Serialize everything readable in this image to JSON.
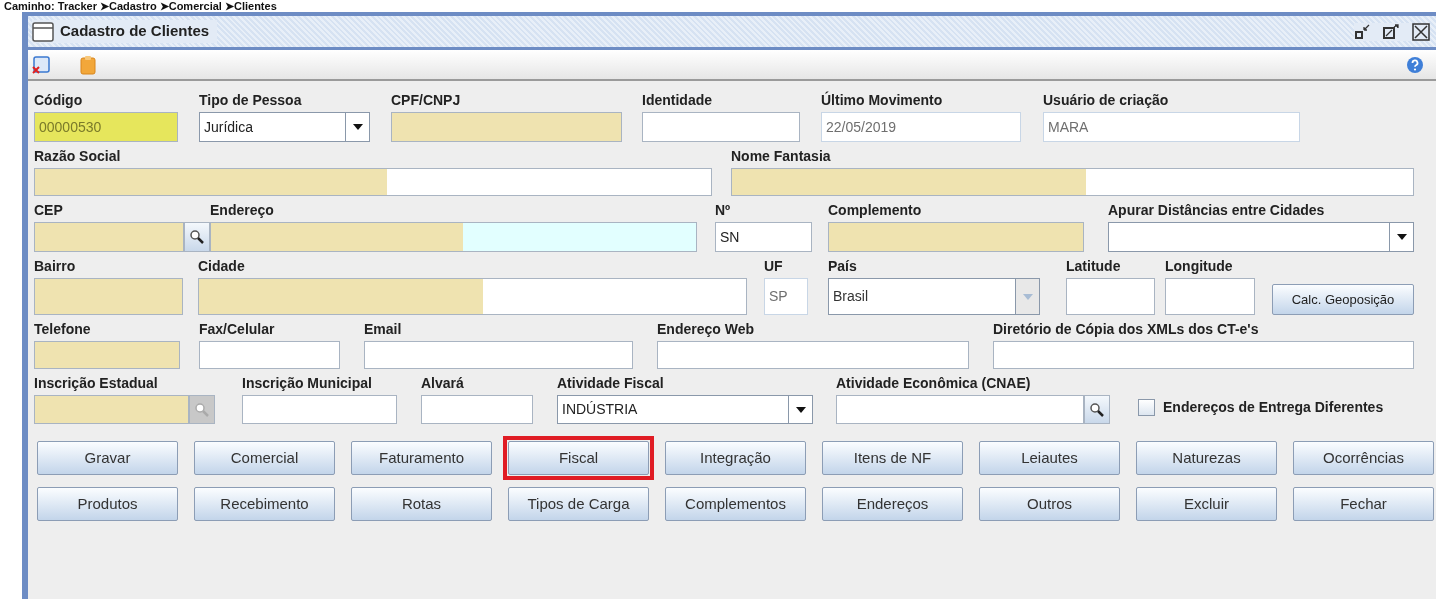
{
  "breadcrumb": "Caminho: Tracker ➤Cadastro ➤Comercial ➤Clientes",
  "window": {
    "title": "Cadastro de Clientes"
  },
  "rows": [
    [
      {
        "kind": "key",
        "label": "Código",
        "value": "00000530",
        "required": false,
        "partial": false
      },
      {
        "kind": "combo",
        "label": "Tipo de Pessoa",
        "value": "Jurídica",
        "required": false,
        "partial": false
      },
      {
        "kind": "text",
        "label": "CPF/CNPJ",
        "required": true,
        "partial": false
      },
      {
        "kind": "text",
        "label": "Identidade",
        "required": false,
        "partial": false
      },
      {
        "kind": "text",
        "label": "Último Movimento",
        "value": "22/05/2019",
        "required": false,
        "partial": false,
        "disabled": true
      },
      {
        "kind": "text",
        "label": "Usuário de criação",
        "value": "MARA",
        "required": false,
        "partial": false,
        "disabled": true
      }
    ],
    [
      {
        "kind": "text",
        "label": "Razão Social",
        "required": false,
        "partial": true
      },
      {
        "kind": "text",
        "label": "Nome Fantasia",
        "required": false,
        "partial": true
      }
    ],
    [
      {
        "kind": "lookup",
        "label": "CEP",
        "required": true,
        "partial": false,
        "disabled": false
      },
      {
        "kind": "text",
        "label": "Endereço",
        "required": false,
        "partial": true,
        "focused": true
      },
      {
        "kind": "text",
        "label": "Nº",
        "value": "SN",
        "required": false,
        "partial": false
      },
      {
        "kind": "text",
        "label": "Complemento",
        "required": true,
        "partial": false
      },
      {
        "kind": "combo",
        "label": "Apurar Distâncias entre Cidades",
        "required": false,
        "partial": false
      }
    ],
    [
      {
        "kind": "text",
        "label": "Bairro",
        "required": true,
        "partial": false
      },
      {
        "kind": "text",
        "label": "Cidade",
        "required": false,
        "partial": true
      },
      {
        "kind": "text",
        "label": "UF",
        "value": "SP",
        "required": false,
        "partial": false,
        "disabled": true
      },
      {
        "kind": "combo",
        "label": "País",
        "value": "Brasil",
        "required": false,
        "partial": false,
        "disabled": true
      },
      {
        "kind": "text",
        "label": "Latitude",
        "required": false,
        "partial": false
      },
      {
        "kind": "text",
        "label": "Longitude",
        "required": false,
        "partial": false
      },
      {
        "kind": "button",
        "label": "Calc. Geoposição"
      }
    ],
    [
      {
        "kind": "text",
        "label": "Telefone",
        "required": true,
        "partial": false
      },
      {
        "kind": "text",
        "label": "Fax/Celular",
        "required": false,
        "partial": false
      },
      {
        "kind": "text",
        "label": "Email",
        "required": false,
        "partial": false
      },
      {
        "kind": "text",
        "label": "Endereço Web",
        "required": false,
        "partial": false
      },
      {
        "kind": "text",
        "label": "Diretório de Cópia dos XMLs dos CT-e's",
        "required": false,
        "partial": false
      }
    ],
    [
      {
        "kind": "lookup",
        "label": "Inscrição Estadual",
        "required": true,
        "partial": false,
        "disabled": true
      },
      {
        "kind": "text",
        "label": "Inscrição Municipal",
        "required": false,
        "partial": false
      },
      {
        "kind": "text",
        "label": "Alvará",
        "required": false,
        "partial": false
      },
      {
        "kind": "combo",
        "label": "Atividade Fiscal",
        "value": "INDÚSTRIA",
        "required": false,
        "partial": false
      },
      {
        "kind": "lookup",
        "label": "Atividade Econômica (CNAE)",
        "required": false,
        "partial": false,
        "disabled": false
      },
      {
        "kind": "checkbox",
        "label": "Endereços de Entrega Diferentes",
        "checked": false
      }
    ]
  ],
  "buttons": [
    [
      {
        "label": "Gravar",
        "highlighted": false
      },
      {
        "label": "Comercial",
        "highlighted": false
      },
      {
        "label": "Faturamento",
        "highlighted": false
      },
      {
        "label": "Fiscal",
        "highlighted": true
      },
      {
        "label": "Integração",
        "highlighted": false
      },
      {
        "label": "Itens de NF",
        "highlighted": false
      },
      {
        "label": "Leiautes",
        "highlighted": false
      },
      {
        "label": "Naturezas",
        "highlighted": false
      },
      {
        "label": "Ocorrências",
        "highlighted": false
      }
    ],
    [
      {
        "label": "Produtos",
        "highlighted": false
      },
      {
        "label": "Recebimento",
        "highlighted": false
      },
      {
        "label": "Rotas",
        "highlighted": false
      },
      {
        "label": "Tipos de Carga",
        "highlighted": false
      },
      {
        "label": "Complementos",
        "highlighted": false
      },
      {
        "label": "Endereços",
        "highlighted": false
      },
      {
        "label": "Outros",
        "highlighted": false
      },
      {
        "label": "Excluir",
        "highlighted": false
      },
      {
        "label": "Fechar",
        "highlighted": false
      }
    ]
  ]
}
